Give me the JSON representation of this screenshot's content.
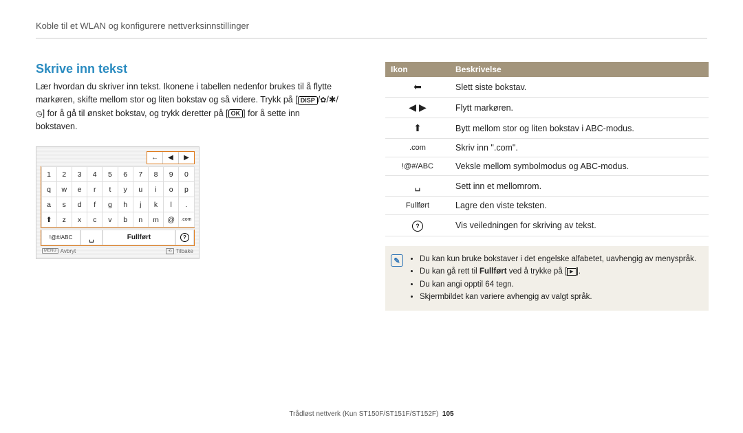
{
  "header": "Koble til et WLAN og konfigurere nettverksinnstillinger",
  "section_title": "Skrive inn tekst",
  "intro_1": "Lær hvordan du skriver inn tekst. Ikonene i tabellen nedenfor brukes til å flytte markøren, skifte mellom stor og liten bokstav og så videre. Trykk på",
  "intro_disp": "DISP",
  "intro_2": "for å gå til ønsket bokstav, og trykk deretter på",
  "intro_ok": "OK",
  "intro_3": "for å sette inn bokstaven.",
  "keyboard": {
    "rows": [
      [
        "1",
        "2",
        "3",
        "4",
        "5",
        "6",
        "7",
        "8",
        "9",
        "0"
      ],
      [
        "q",
        "w",
        "e",
        "r",
        "t",
        "y",
        "u",
        "i",
        "o",
        "p"
      ],
      [
        "a",
        "s",
        "d",
        "f",
        "g",
        "h",
        "j",
        "k",
        "l",
        "."
      ],
      [
        "⬆",
        "z",
        "x",
        "c",
        "v",
        "b",
        "n",
        "m",
        "@",
        ".com"
      ]
    ],
    "bottom": {
      "mode": "!@#/ABC",
      "space": "␣",
      "done": "Fullført",
      "help": "?"
    },
    "top_icons": [
      "←",
      "◀",
      "▶"
    ],
    "footer_left_box": "MENU",
    "footer_left": "Avbryt",
    "footer_right_box": "⟲",
    "footer_right": "Tilbake"
  },
  "table": {
    "hdr_icon": "Ikon",
    "hdr_desc": "Beskrivelse",
    "rows": [
      {
        "icon": "backspace",
        "glyph": "⬅",
        "desc": "Slett siste bokstav."
      },
      {
        "icon": "move-cursor",
        "glyph": "◀ ▶",
        "desc": "Flytt markøren."
      },
      {
        "icon": "shift",
        "glyph": "⬆",
        "desc": "Bytt mellom stor og liten bokstav i ABC-modus."
      },
      {
        "icon": "dotcom",
        "glyph": ".com",
        "desc": "Skriv inn \".com\"."
      },
      {
        "icon": "mode-switch",
        "glyph": "!@#/ABC",
        "desc": "Veksle mellom symbolmodus og ABC-modus."
      },
      {
        "icon": "space",
        "glyph": "␣",
        "desc": "Sett inn et mellomrom."
      },
      {
        "icon": "done",
        "glyph": "Fullført",
        "desc": "Lagre den viste teksten."
      },
      {
        "icon": "help",
        "glyph": "?",
        "desc": "Vis veiledningen for skriving av tekst."
      }
    ]
  },
  "notes": {
    "n1": "Du kan kun bruke bokstaver i det engelske alfabetet, uavhengig av menyspråk.",
    "n2a": "Du kan gå rett til ",
    "n2b": "Fullført",
    "n2c": " ved å trykke på ",
    "n3": "Du kan angi opptil 64 tegn.",
    "n4": "Skjermbildet kan variere avhengig av valgt språk."
  },
  "footer": {
    "text": "Trådløst nettverk (Kun ST150F/ST151F/ST152F)",
    "page": "105"
  }
}
